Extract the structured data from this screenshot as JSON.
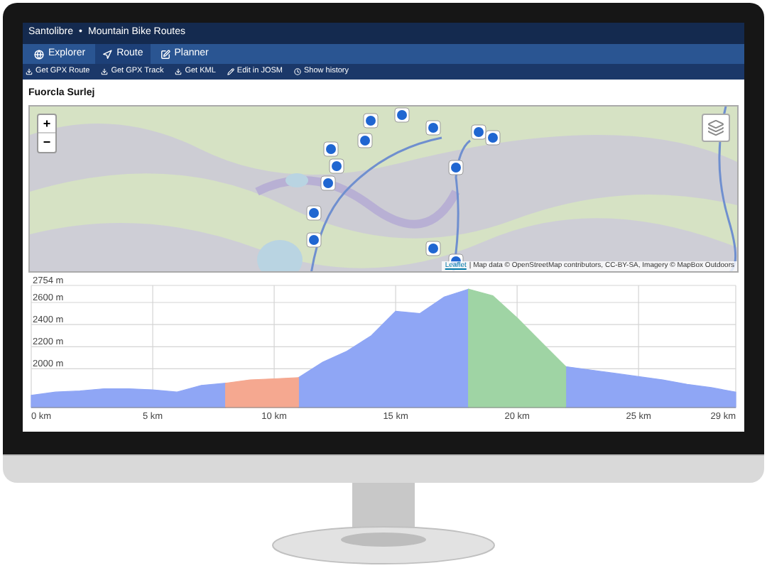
{
  "app": {
    "brand": "Santolibre",
    "separator": "•",
    "section": "Mountain Bike Routes"
  },
  "tabs": [
    {
      "label": "Explorer",
      "kind": "explore",
      "selected": false
    },
    {
      "label": "Route",
      "kind": "route",
      "selected": true
    },
    {
      "label": "Planner",
      "kind": "planner",
      "selected": false
    }
  ],
  "actions": [
    {
      "label": "Get GPX Route",
      "kind": "download"
    },
    {
      "label": "Get GPX Track",
      "kind": "download"
    },
    {
      "label": "Get KML",
      "kind": "download"
    },
    {
      "label": "Edit in JOSM",
      "kind": "edit"
    },
    {
      "label": "Show history",
      "kind": "history"
    }
  ],
  "route_title": "Fuorcla Surlej",
  "map": {
    "zoom_in": "+",
    "zoom_out": "−",
    "attribution_link": "Leaflet",
    "attribution": "| Map data © OpenStreetMap contributors, CC-BY-SA, Imagery © MapBox Outdoors"
  },
  "profile": {
    "chart_data": {
      "type": "area",
      "x": [
        0,
        1,
        2,
        3,
        4,
        5,
        6,
        7,
        8,
        9,
        10,
        11,
        12,
        13,
        14,
        15,
        16,
        17,
        18,
        19,
        20,
        21,
        22,
        23,
        24,
        25,
        26,
        27,
        28,
        29
      ],
      "series": [
        {
          "color": "#8fa6f5",
          "values": [
            1760,
            1790,
            1800,
            1820,
            1820,
            1810,
            1790,
            1850,
            1870,
            null,
            null,
            1920,
            2060,
            2160,
            2300,
            2520,
            2500,
            2650,
            2720,
            null,
            null,
            null,
            2020,
            1990,
            1960,
            1930,
            1900,
            1860,
            1830,
            1790
          ]
        },
        {
          "color": "#f5a890",
          "values": [
            null,
            null,
            null,
            null,
            null,
            null,
            null,
            null,
            1870,
            1900,
            1910,
            1920,
            null,
            null,
            null,
            null,
            null,
            null,
            null,
            null,
            null,
            null,
            null,
            null,
            null,
            null,
            null,
            null,
            null,
            null
          ]
        },
        {
          "color": "#9fd4a4",
          "values": [
            null,
            null,
            null,
            null,
            null,
            null,
            null,
            null,
            null,
            null,
            null,
            null,
            null,
            null,
            null,
            null,
            null,
            null,
            2720,
            2660,
            2460,
            2240,
            2020,
            null,
            null,
            null,
            null,
            null,
            null,
            null
          ]
        }
      ],
      "grid": true,
      "xlim": [
        0,
        29
      ],
      "ylim": [
        1650,
        2754
      ],
      "xticks": [
        {
          "value": 0,
          "label": "0 km"
        },
        {
          "value": 5,
          "label": "5 km"
        },
        {
          "value": 10,
          "label": "10 km"
        },
        {
          "value": 15,
          "label": "15 km"
        },
        {
          "value": 20,
          "label": "20 km"
        },
        {
          "value": 25,
          "label": "25 km"
        },
        {
          "value": 29,
          "label": "29 km"
        }
      ],
      "yticks": [
        {
          "value": 2000,
          "label": "2000 m"
        },
        {
          "value": 2200,
          "label": "2200 m"
        },
        {
          "value": 2400,
          "label": "2400 m"
        },
        {
          "value": 2600,
          "label": "2600 m"
        },
        {
          "value": 2754,
          "label": "2754 m"
        }
      ]
    }
  }
}
